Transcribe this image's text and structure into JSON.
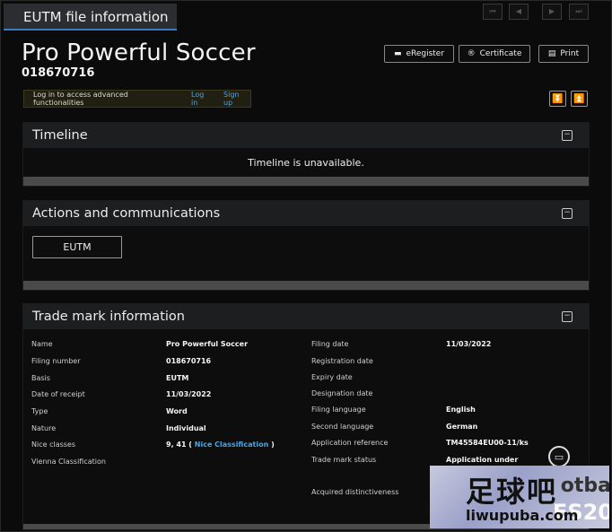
{
  "header": {
    "tab_title": "EUTM file information"
  },
  "pager": {
    "first": "⏮",
    "prev": "◀",
    "next": "▶",
    "last": "⏭"
  },
  "mark": {
    "title": "Pro Powerful Soccer",
    "file_number": "018670716"
  },
  "toolbar": {
    "eregister": "eRegister",
    "eregister_icon": "folder-icon",
    "certificate": "Certificate",
    "certificate_icon": "registered-icon",
    "print": "Print",
    "print_icon": "printer-icon"
  },
  "login": {
    "message": "Log in to access advanced functionalities",
    "login": "Log in",
    "signup": "Sign up"
  },
  "timeline": {
    "heading": "Timeline",
    "message": "Timeline is unavailable."
  },
  "actions": {
    "heading": "Actions and communications",
    "eutm_button": "EUTM"
  },
  "tm_info": {
    "heading": "Trade mark information",
    "left": [
      {
        "label": "Name",
        "value": "Pro Powerful Soccer"
      },
      {
        "label": "Filing number",
        "value": "018670716"
      },
      {
        "label": "Basis",
        "value": "EUTM"
      },
      {
        "label": "Date of receipt",
        "value": "11/03/2022"
      },
      {
        "label": "Type",
        "value": "Word"
      },
      {
        "label": "Nature",
        "value": "Individual"
      },
      {
        "label": "Nice classes",
        "value": "9, 41 (",
        "link": "Nice Classification",
        "suffix": ")"
      },
      {
        "label": "Vienna Classification",
        "value": ""
      }
    ],
    "right": [
      {
        "label": "Filing date",
        "value": "11/03/2022"
      },
      {
        "label": "Registration date",
        "value": ""
      },
      {
        "label": "Expiry date",
        "value": ""
      },
      {
        "label": "Designation date",
        "value": ""
      },
      {
        "label": "Filing language",
        "value": "English"
      },
      {
        "label": "Second language",
        "value": "German"
      },
      {
        "label": "Application reference",
        "value": "TM45584EU00-11/ks"
      },
      {
        "label": "Trade mark status",
        "value": "Application under"
      },
      {
        "label": "Acquired distinctiveness",
        "value": ""
      }
    ]
  },
  "watermark": {
    "chars": "足球吧",
    "url": "liwupuba.com",
    "bg1": "otba",
    "bg2": "ES20"
  }
}
